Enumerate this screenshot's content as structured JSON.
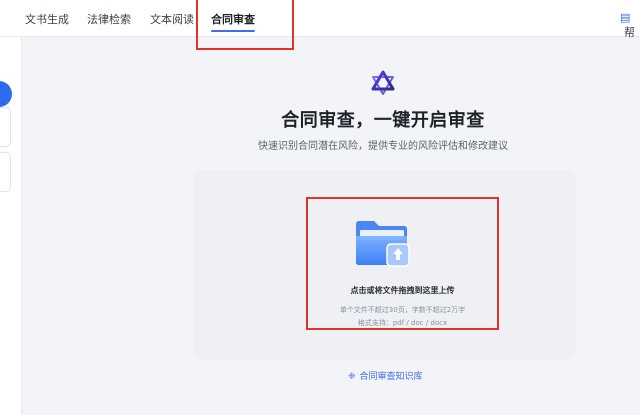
{
  "tabs": [
    {
      "label": "文书生成"
    },
    {
      "label": "法律检索"
    },
    {
      "label": "文本阅读"
    },
    {
      "label": "合同审查",
      "active": true
    }
  ],
  "top_right": {
    "label": "帮"
  },
  "main": {
    "title": "合同审查，一键开启审查",
    "subtitle": "快速识别合同潜在风险，提供专业的风险评估和修改建议",
    "upload": {
      "main_text": "点击或将文件拖拽到这里上传",
      "hint_size": "单个文件不超过30页，字数不超过2万字",
      "hint_format": "格式支持：pdf / doc / docx"
    },
    "knowledge_link": "合同审查知识库"
  },
  "colors": {
    "accent": "#3f6bf5",
    "highlight": "#e5312b",
    "background": "#f3f4f7"
  },
  "icons": [
    "app-logo-icon",
    "folder-upload-icon",
    "search-icon",
    "knowledge-base-icon",
    "document-icon"
  ]
}
